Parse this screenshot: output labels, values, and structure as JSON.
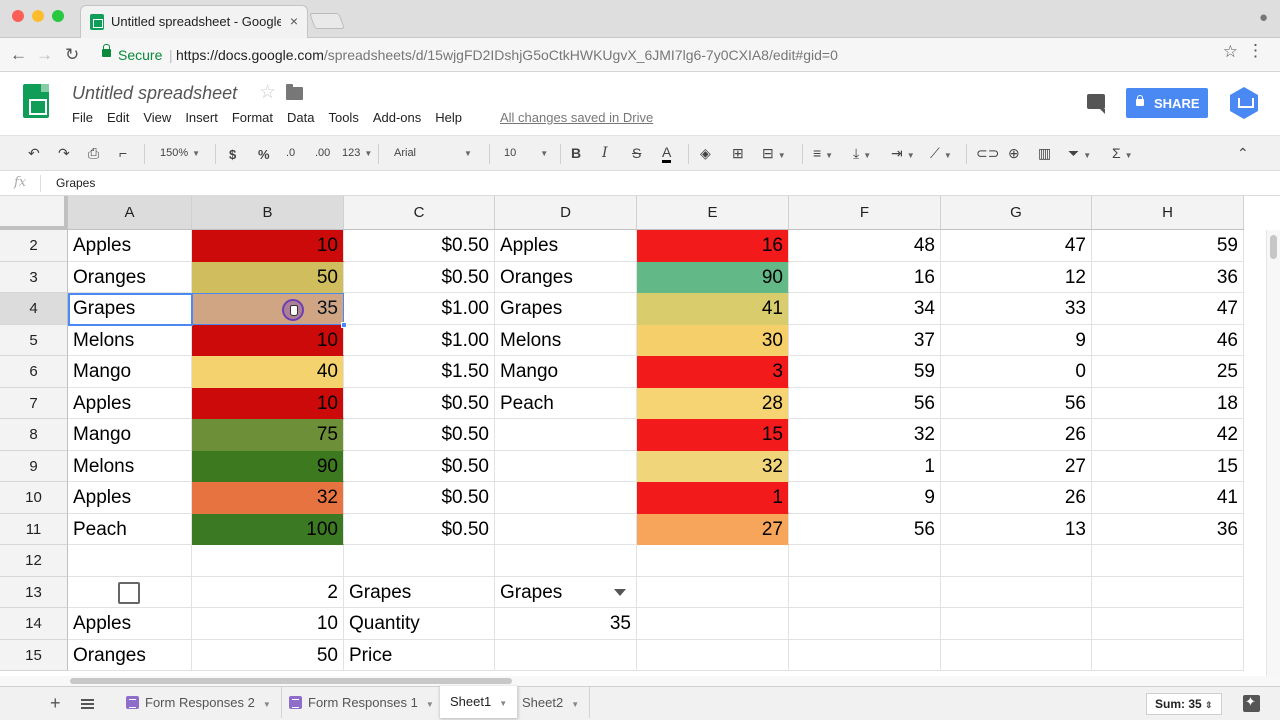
{
  "browser": {
    "tab_title": "Untitled spreadsheet - Google Sheets",
    "tab_close": "×",
    "secure_label": "Secure",
    "url_host": "https://docs.google.com",
    "url_rest": "/spreadsheets/d/15wjgFD2IDshjG5oCtkHWKUgvX_6JMI7lg6-7y0CXIA8/edit#gid=0"
  },
  "doc": {
    "title": "Untitled spreadsheet",
    "menu": [
      "File",
      "Edit",
      "View",
      "Insert",
      "Format",
      "Data",
      "Tools",
      "Add-ons",
      "Help"
    ],
    "save_status": "All changes saved in Drive",
    "share_label": "SHARE"
  },
  "toolbar": {
    "zoom": "150%",
    "currency": "$",
    "percent": "%",
    "dec_less": ".0",
    "dec_more": ".00",
    "more_formats": "123",
    "font": "Arial",
    "font_size": "10",
    "bold": "B",
    "italic": "I",
    "strike": "S",
    "text_color": "A",
    "functions": "Σ"
  },
  "formula_bar": {
    "fx": "fx",
    "value": "Grapes"
  },
  "grid": {
    "columns": [
      "A",
      "B",
      "C",
      "D",
      "E",
      "F",
      "G",
      "H"
    ],
    "rows": [
      {
        "n": "2",
        "A": "Apples",
        "B": "10",
        "C": "$0.50",
        "D": "Apples",
        "E": "16",
        "F": "48",
        "G": "47",
        "H": "59",
        "B_color": "#cc0a0a",
        "E_color": "#f21a1a"
      },
      {
        "n": "3",
        "A": "Oranges",
        "B": "50",
        "C": "$0.50",
        "D": "Oranges",
        "E": "90",
        "F": "16",
        "G": "12",
        "H": "36",
        "B_color": "#d0bd5e",
        "E_color": "#62b987"
      },
      {
        "n": "4",
        "A": "Grapes",
        "B": "35",
        "C": "$1.00",
        "D": "Grapes",
        "E": "41",
        "F": "34",
        "G": "33",
        "H": "47",
        "B_color": "#e2a974",
        "E_color": "#d8cc6c"
      },
      {
        "n": "5",
        "A": "Melons",
        "B": "10",
        "C": "$1.00",
        "D": "Melons",
        "E": "30",
        "F": "37",
        "G": "9",
        "H": "46",
        "B_color": "#cc0a0a",
        "E_color": "#f5cf6a"
      },
      {
        "n": "6",
        "A": "Mango",
        "B": "40",
        "C": "$1.50",
        "D": "Mango",
        "E": "3",
        "F": "59",
        "G": "0",
        "H": "25",
        "B_color": "#f4d36e",
        "E_color": "#f21a1a"
      },
      {
        "n": "7",
        "A": "Apples",
        "B": "10",
        "C": "$0.50",
        "D": "Peach",
        "E": "28",
        "F": "56",
        "G": "56",
        "H": "18",
        "B_color": "#cc0a0a",
        "E_color": "#f6d474"
      },
      {
        "n": "8",
        "A": "Mango",
        "B": "75",
        "C": "$0.50",
        "D": "",
        "E": "15",
        "F": "32",
        "G": "26",
        "H": "42",
        "B_color": "#6d8f37",
        "E_color": "#f21a1a"
      },
      {
        "n": "9",
        "A": "Melons",
        "B": "90",
        "C": "$0.50",
        "D": "",
        "E": "32",
        "F": "1",
        "G": "27",
        "H": "15",
        "B_color": "#3d7a1f",
        "E_color": "#f1d57a"
      },
      {
        "n": "10",
        "A": "Apples",
        "B": "32",
        "C": "$0.50",
        "D": "",
        "E": "1",
        "F": "9",
        "G": "26",
        "H": "41",
        "B_color": "#e77440",
        "E_color": "#f21a1a"
      },
      {
        "n": "11",
        "A": "Peach",
        "B": "100",
        "C": "$0.50",
        "D": "",
        "E": "27",
        "F": "56",
        "G": "13",
        "H": "36",
        "B_color": "#3b7a22",
        "E_color": "#f8a55c"
      }
    ],
    "row12": "12",
    "row13": {
      "n": "13",
      "B": "2",
      "C": "Grapes",
      "D": "Grapes"
    },
    "row14": {
      "n": "14",
      "A": "Apples",
      "B": "10",
      "C": "Quantity",
      "D": "35"
    },
    "row15": {
      "n": "15",
      "A": "Oranges",
      "B": "50",
      "C": "Price"
    }
  },
  "sheets": {
    "tabs": [
      "Form Responses 2",
      "Form Responses 1",
      "Sheet1",
      "Sheet2"
    ],
    "active": "Sheet1",
    "sum": "Sum: 35"
  },
  "colors": {
    "accent": "#4a89f3",
    "sheets_green": "#0f9d58"
  }
}
